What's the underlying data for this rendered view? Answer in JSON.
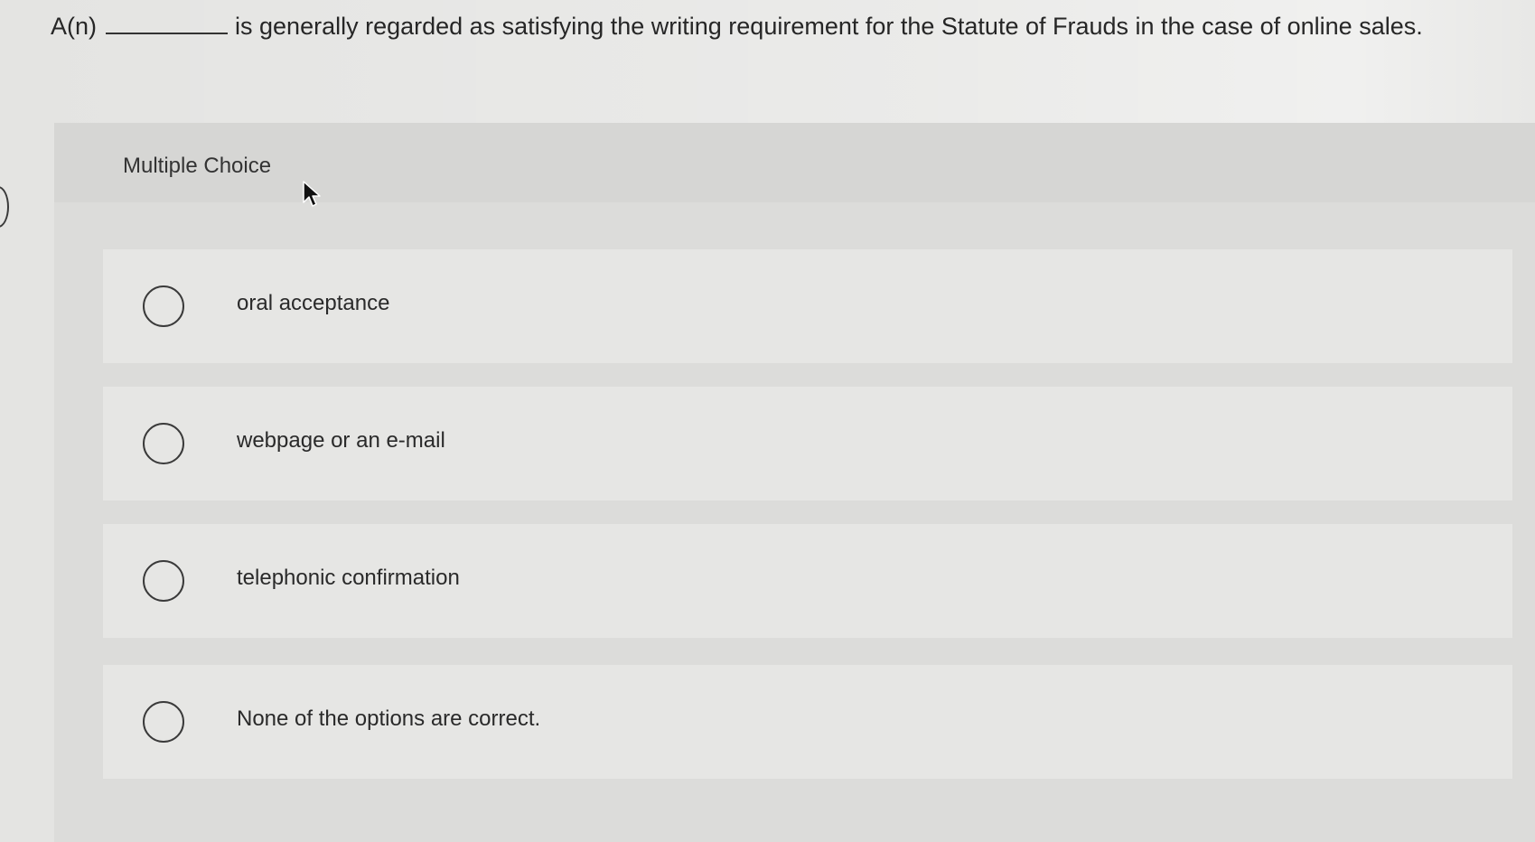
{
  "question": {
    "prefix": "A(n)",
    "suffix": "is generally regarded as satisfying the writing requirement for the Statute of Frauds in the case of online sales."
  },
  "question_type": "Multiple Choice",
  "options": [
    {
      "label": "oral acceptance",
      "selected": false
    },
    {
      "label": "webpage or an e-mail",
      "selected": false
    },
    {
      "label": "telephonic confirmation",
      "selected": false
    },
    {
      "label": "None of the options are correct.",
      "selected": false
    }
  ],
  "icons": {
    "cursor": "mouse-pointer-icon",
    "radio": "radio-button-icon"
  },
  "colors": {
    "background": "#e4e4e2",
    "panel": "#dcdcda",
    "option_bg": "#e6e6e4",
    "text": "#2b2b2b"
  }
}
